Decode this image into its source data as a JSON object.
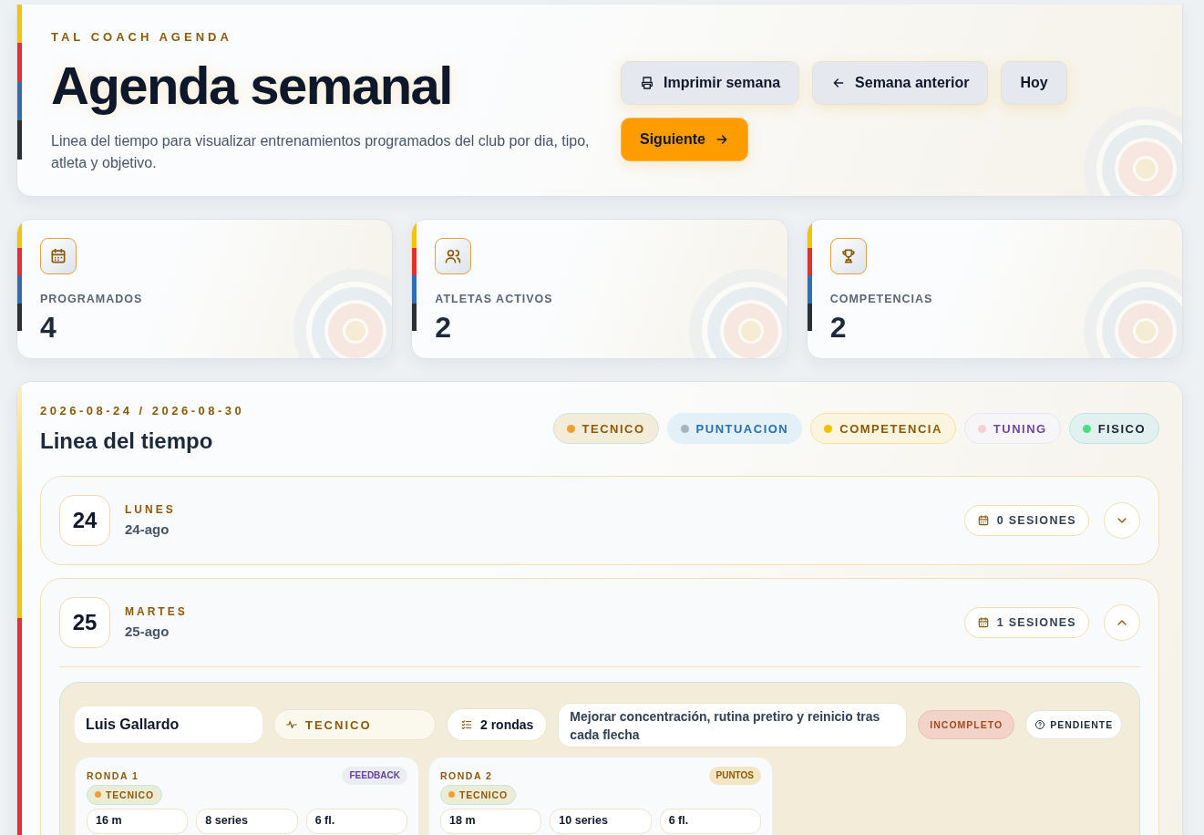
{
  "header": {
    "eyebrow": "TAL COACH AGENDA",
    "title": "Agenda semanal",
    "description": "Linea del tiempo para visualizar entrenamientos programados del club por dia, tipo, atleta y objetivo.",
    "buttons": [
      {
        "label": "Imprimir semana",
        "kind": "print"
      },
      {
        "label": "Semana anterior",
        "kind": "prev"
      },
      {
        "label": "Hoy",
        "kind": "plain"
      },
      {
        "label": "Siguiente",
        "kind": "next"
      }
    ]
  },
  "stats": [
    {
      "label": "PROGRAMADOS",
      "value": "4",
      "kind": "calendar"
    },
    {
      "label": "ATLETAS ACTIVOS",
      "value": "2",
      "kind": "users"
    },
    {
      "label": "COMPETENCIAS",
      "value": "2",
      "kind": "trophy"
    }
  ],
  "timeline": {
    "range": "2026-08-24 / 2026-08-30",
    "title": "Linea del tiempo",
    "legend": [
      {
        "label": "TECNICO",
        "kind": "tecnico",
        "color": "#f0a030"
      },
      {
        "label": "PUNTUACION",
        "kind": "puntuacion",
        "color": "#aab4be"
      },
      {
        "label": "COMPETENCIA",
        "kind": "competencia",
        "color": "#f5c000"
      },
      {
        "label": "TUNING",
        "kind": "tuning",
        "color": "#f6cfd4"
      },
      {
        "label": "FISICO",
        "kind": "fisico",
        "color": "#4ade80"
      }
    ],
    "days": [
      {
        "number": "24",
        "weekday": "LUNES",
        "date": "24-ago",
        "sessions": "0 SESIONES",
        "expanded": false
      },
      {
        "number": "25",
        "weekday": "MARTES",
        "date": "25-ago",
        "sessions": "1 SESIONES",
        "expanded": true,
        "entries": [
          {
            "athlete": "Luis Gallardo",
            "type": "TECNICO",
            "rounds": "2 rondas",
            "goal": "Mejorar concentración, rutina pretiro y reinicio tras cada flecha",
            "result": "INCOMPLETO",
            "status": "PENDIENTE",
            "rondas": [
              {
                "title": "RONDA 1",
                "tag": "FEEDBACK",
                "kind": "feedback",
                "type": "TECNICO",
                "stats": [
                  "16 m",
                  "8 series",
                  "6 fl."
                ]
              },
              {
                "title": "RONDA 2",
                "tag": "PUNTOS",
                "kind": "puntos",
                "type": "TECNICO",
                "stats": [
                  "18 m",
                  "10 series",
                  "6 fl."
                ]
              }
            ]
          }
        ]
      }
    ]
  }
}
